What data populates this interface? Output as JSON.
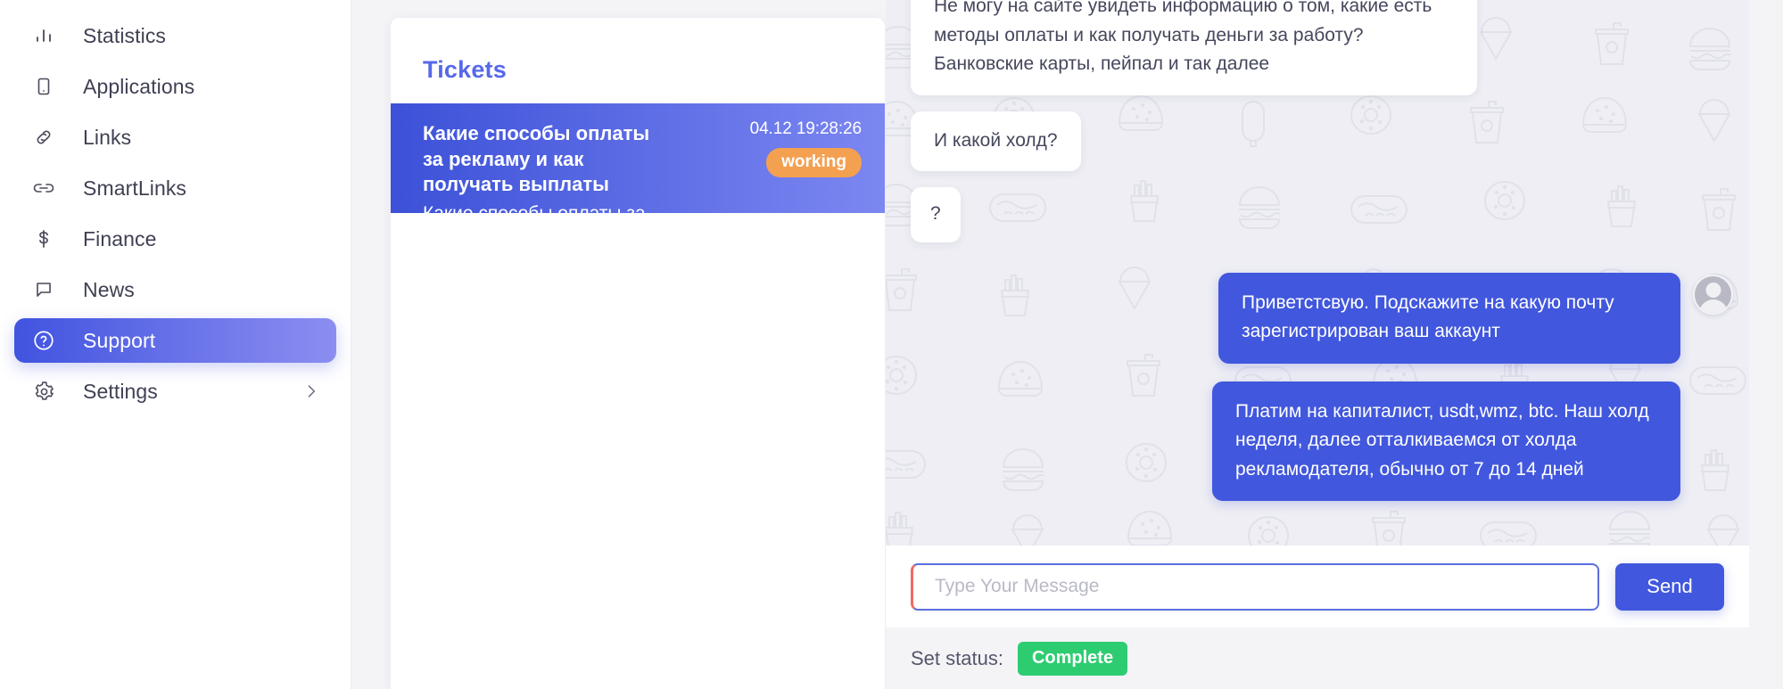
{
  "sidebar": {
    "items": [
      {
        "label": "Statistics",
        "icon": "bar-chart-icon",
        "active": false,
        "chevron": false
      },
      {
        "label": "Applications",
        "icon": "mobile-icon",
        "active": false,
        "chevron": false
      },
      {
        "label": "Links",
        "icon": "link-icon",
        "active": false,
        "chevron": false
      },
      {
        "label": "SmartLinks",
        "icon": "smart-link-icon",
        "active": false,
        "chevron": false
      },
      {
        "label": "Finance",
        "icon": "dollar-icon",
        "active": false,
        "chevron": false
      },
      {
        "label": "News",
        "icon": "chat-bubble-icon",
        "active": false,
        "chevron": false
      },
      {
        "label": "Support",
        "icon": "help-circle-icon",
        "active": true,
        "chevron": false
      },
      {
        "label": "Settings",
        "icon": "gear-icon",
        "active": false,
        "chevron": true
      }
    ]
  },
  "tickets": {
    "title": "Tickets",
    "list": [
      {
        "subject": "Какие способы оплаты за рекламу и как получать выплаты",
        "preview": "Какие способы оплаты за ...",
        "time": "04.12 19:28:26",
        "status": "working",
        "selected": true
      }
    ]
  },
  "chat": {
    "messages": [
      {
        "direction": "in",
        "text": "Не могу на сайте увидеть информацию о том, какие есть методы оплаты и как получать деньги за работу? Банковские карты, пейпал и так далее",
        "clipped": true
      },
      {
        "direction": "in",
        "text": "И какой холд?"
      },
      {
        "direction": "in",
        "text": "?"
      },
      {
        "direction": "out",
        "text": "Приветстсвую. Подскажите на какую почту зарегистрирован ваш аккаунт",
        "avatar": true
      },
      {
        "direction": "out",
        "text": "Платим на капиталист, usdt,wmz, btc. Наш холд неделя, далее отталкиваемся от холда рекламодателя, обычно от 7 до 14 дней",
        "avatar": false
      }
    ]
  },
  "composer": {
    "placeholder": "Type Your Message",
    "value": "",
    "send_label": "Send"
  },
  "status": {
    "label": "Set status:",
    "complete_label": "Complete"
  },
  "colors": {
    "accent_blue": "#4157dd",
    "tickets_title": "#5768e8",
    "badge_working": "#f4a051",
    "badge_complete": "#2ecc71",
    "input_accent": "#f4695f",
    "chat_bg": "#eeeef4"
  }
}
